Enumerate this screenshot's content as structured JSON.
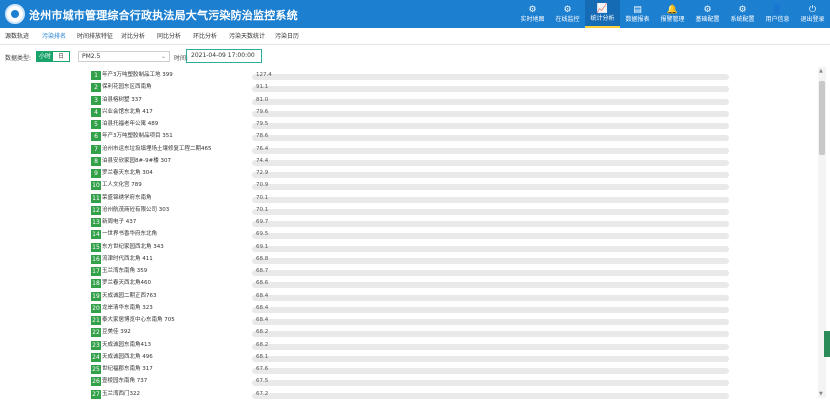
{
  "app": {
    "title": "沧州市城市管理综合行政执法局大气污染防治监控系统"
  },
  "nav": [
    {
      "label": "实时地图",
      "icon": "⚙"
    },
    {
      "label": "在线监控",
      "icon": "⚙"
    },
    {
      "label": "统计分析",
      "icon": "📈",
      "active": true
    },
    {
      "label": "数据报表",
      "icon": "▤"
    },
    {
      "label": "报警管理",
      "icon": "🔔"
    },
    {
      "label": "基础配置",
      "icon": "⚙"
    },
    {
      "label": "系统配置",
      "icon": "⚙"
    },
    {
      "label": "用户信息",
      "icon": "👤"
    },
    {
      "label": "退出登录",
      "icon": "⏻"
    }
  ],
  "tabs": [
    "源数轨迹",
    "污染排名",
    "时间排放特征",
    "对比分析",
    "同比分析",
    "环比分析",
    "污染天数统计",
    "污染日历"
  ],
  "active_tab": 1,
  "filter": {
    "data_type_label": "数据类型:",
    "toggle_on": "小时",
    "toggle_off": "日",
    "pollutant": "PM2.5",
    "time_label": "时间:",
    "time_value": "2021-04-09 17:00:00"
  },
  "ranking": [
    {
      "rank": "1",
      "name": "年产3万吨塑胶制品工地 399",
      "value": "127.4"
    },
    {
      "rank": "2",
      "name": "保利花园东区西南角",
      "value": "91.1"
    },
    {
      "rank": "3",
      "name": "泊县榕树墅 337",
      "value": "81.0"
    },
    {
      "rank": "4",
      "name": "兴业会馆东北角 417",
      "value": "79.6"
    },
    {
      "rank": "5",
      "name": "泊县托福老年公寓 489",
      "value": "79.5"
    },
    {
      "rank": "6",
      "name": "年产3万吨塑胶制品项目 351",
      "value": "78.6"
    },
    {
      "rank": "7",
      "name": "沧州市运东垃圾填埋场土壤修复工程二期465",
      "value": "76.4"
    },
    {
      "rank": "8",
      "name": "泊县安欣家园8#-9#楼 307",
      "value": "74.4"
    },
    {
      "rank": "9",
      "name": "罗兰春天东北角 304",
      "value": "72.9"
    },
    {
      "rank": "10",
      "name": "工人文化宫 789",
      "value": "70.9"
    },
    {
      "rank": "11",
      "name": "荣盛锦绣学府东南角",
      "value": "70.1"
    },
    {
      "rank": "12",
      "name": "沧州航茂商砼有限公司 303",
      "value": "70.1"
    },
    {
      "rank": "13",
      "name": "新周电子 437",
      "value": "69.7"
    },
    {
      "rank": "14",
      "name": "一世界书香华府东北角",
      "value": "69.5"
    },
    {
      "rank": "15",
      "name": "东方世纪家园西北角 343",
      "value": "69.1"
    },
    {
      "rank": "16",
      "name": "流津时代西北角 411",
      "value": "68.8"
    },
    {
      "rank": "17",
      "name": "玉兰湾东南角 359",
      "value": "68.7"
    },
    {
      "rank": "18",
      "name": "罗兰春天西北角460",
      "value": "68.6"
    },
    {
      "rank": "19",
      "name": "天成诚园二期正西763",
      "value": "68.4"
    },
    {
      "rank": "20",
      "name": "龙岸清华东南角 323",
      "value": "68.4"
    },
    {
      "rank": "21",
      "name": "泰大家居博览中心东南角 705",
      "value": "68.4"
    },
    {
      "rank": "22",
      "name": "豆美佳 392",
      "value": "68.2"
    },
    {
      "rank": "23",
      "name": "天成诚园东南角413",
      "value": "68.2"
    },
    {
      "rank": "24",
      "name": "天成诚园西北角 496",
      "value": "68.1"
    },
    {
      "rank": "25",
      "name": "世纪福郡东南角 317",
      "value": "67.6"
    },
    {
      "rank": "26",
      "name": "壹棱园东南角 737",
      "value": "67.5"
    },
    {
      "rank": "27",
      "name": "玉兰湾西门322",
      "value": "67.2"
    }
  ]
}
